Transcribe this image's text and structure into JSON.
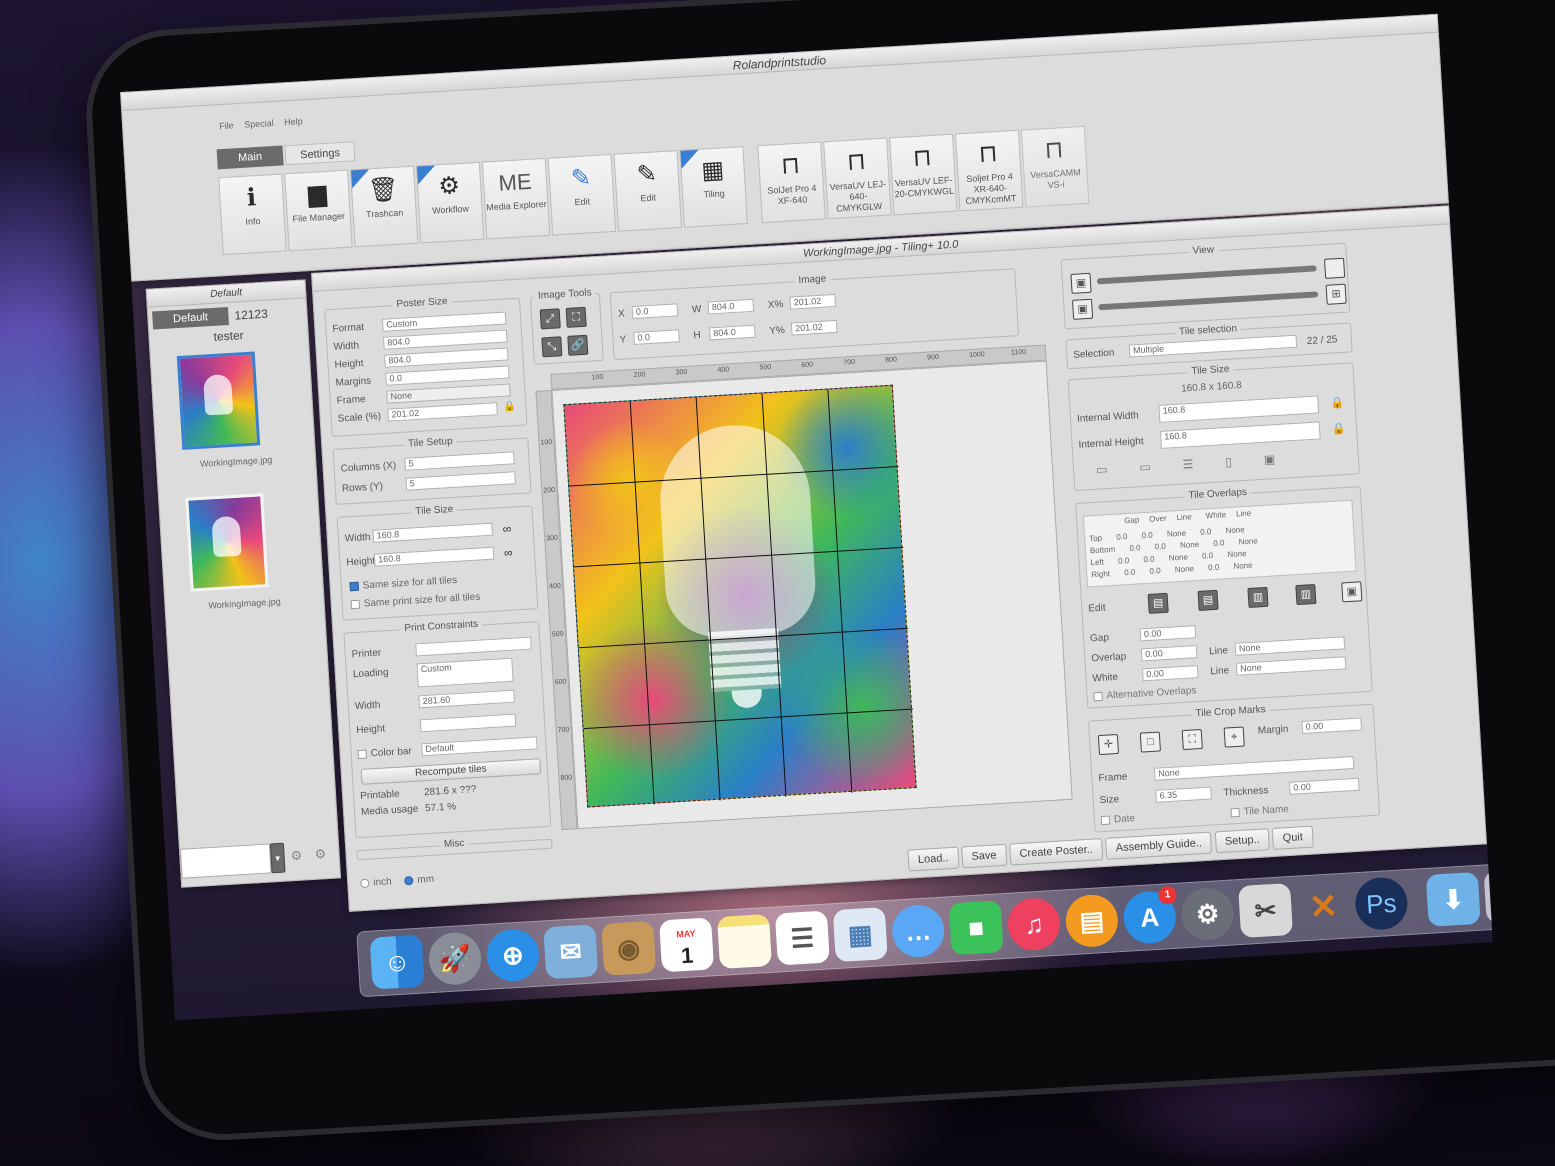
{
  "app_title": "Rolandprintstudio",
  "menu": [
    "File",
    "Special",
    "Help"
  ],
  "tabs": {
    "main": "Main",
    "settings": "Settings"
  },
  "toolbar": {
    "info": "Info",
    "file_manager": "File Manager",
    "trashcan": "Trashcan",
    "workflow": "Workflow",
    "media_explorer": "Media Explorer",
    "media_logo": "ME",
    "edit1": "Edit",
    "edit2": "Edit",
    "tiling": "Tiling"
  },
  "printers": [
    {
      "line1": "SolJet Pro 4",
      "line2": "XF-640"
    },
    {
      "line1": "VersaUV LEJ-",
      "line2": "640-CMYKGLW"
    },
    {
      "line1": "VersaUV LEF-",
      "line2": "20-CMYKWGL"
    },
    {
      "line1": "Soljet Pro 4",
      "line2": "XR-640-CMYKcmMT"
    },
    {
      "line1": "VersaCAMM",
      "line2": "VS-i"
    }
  ],
  "queue": {
    "title": "Default",
    "tab": "Default",
    "count": "12123",
    "user": "tester",
    "thumb1": "WorkingImage.jpg",
    "thumb2": "WorkingImage.jpg"
  },
  "tiling_title": "WorkingImage.jpg - Tiling+ 10.0",
  "poster_size": {
    "title": "Poster Size",
    "format_label": "Format",
    "format": "Custom",
    "width_label": "Width",
    "width": "804.0",
    "height_label": "Height",
    "height": "804.0",
    "margins_label": "Margins",
    "margins": "0.0",
    "frame_label": "Frame",
    "frame": "None",
    "scale_label": "Scale (%)",
    "scale": "201.02"
  },
  "tile_setup": {
    "title": "Tile Setup",
    "columns_label": "Columns (X)",
    "columns": "5",
    "rows_label": "Rows (Y)",
    "rows": "5"
  },
  "tile_size_left": {
    "title": "Tile Size",
    "width_label": "Width",
    "width": "160.8",
    "height_label": "Height",
    "height": "160.8",
    "same_size": "Same size for all tiles",
    "same_print": "Same print size for all tiles"
  },
  "print_constraints": {
    "title": "Print Constraints",
    "printer_label": "Printer",
    "loading_label": "Loading",
    "loading": "Custom",
    "width_label": "Width",
    "width": "281.60",
    "height_label": "Height",
    "color_bar_label": "Color bar",
    "color_bar": "Default",
    "recompute": "Recompute tiles",
    "printable_label": "Printable",
    "printable": "281.6 x ???",
    "media_usage_label": "Media usage",
    "media_usage": "57.1 %",
    "misc": "Misc"
  },
  "units": {
    "inch": "inch",
    "mm": "mm"
  },
  "image_tools": {
    "title": "Image Tools",
    "image": "Image",
    "x": "0.0",
    "w": "804.0",
    "xpct": "201.02",
    "y": "0.0",
    "h": "804.0",
    "ypct": "201.02",
    "x_label": "X",
    "w_label": "W",
    "xpct_label": "X%",
    "y_label": "Y",
    "h_label": "H",
    "ypct_label": "Y%"
  },
  "ruler_top": [
    "100",
    "200",
    "300",
    "400",
    "500",
    "600",
    "700",
    "800",
    "900",
    "1000",
    "1100"
  ],
  "ruler_left": [
    "100",
    "200",
    "300",
    "400",
    "500",
    "600",
    "700",
    "800"
  ],
  "view": {
    "title": "View"
  },
  "tile_selection": {
    "title": "Tile selection",
    "selection_label": "Selection",
    "selection": "Multiple",
    "count": "22 / 25"
  },
  "tile_size_right": {
    "title": "Tile Size",
    "dims": "160.8 x 160.8",
    "iw_label": "Internal Width",
    "iw": "160.8",
    "ih_label": "Internal Height",
    "ih": "160.8"
  },
  "tile_overlaps": {
    "title": "Tile Overlaps",
    "headers": [
      "",
      "Gap",
      "Over",
      "Line",
      "White",
      "Line"
    ],
    "rows": [
      [
        "Top",
        "0.0",
        "0.0",
        "None",
        "0.0",
        "None"
      ],
      [
        "Bottom",
        "0.0",
        "0.0",
        "None",
        "0.0",
        "None"
      ],
      [
        "Left",
        "0.0",
        "0.0",
        "None",
        "0.0",
        "None"
      ],
      [
        "Right",
        "0.0",
        "0.0",
        "None",
        "0.0",
        "None"
      ]
    ],
    "edit_label": "Edit",
    "gap_label": "Gap",
    "gap": "0.00",
    "overlap_label": "Overlap",
    "overlap": "0.00",
    "white_label": "White",
    "white": "0.00",
    "line_label": "Line",
    "line1": "None",
    "line2": "None",
    "alt": "Alternative Overlaps"
  },
  "crop_marks": {
    "title": "Tile Crop Marks",
    "margin_label": "Margin",
    "margin": "0.00",
    "frame_label": "Frame",
    "frame": "None",
    "size_label": "Size",
    "size": "6.35",
    "thickness_label": "Thickness",
    "thickness": "0.00",
    "date": "Date",
    "tile_name": "Tile Name"
  },
  "actions": {
    "load": "Load..",
    "save": "Save",
    "create": "Create Poster..",
    "assembly": "Assembly Guide..",
    "setup": "Setup..",
    "quit": "Quit"
  },
  "dock": {
    "calendar_month": "MAY",
    "calendar_day": "1",
    "appstore_badge": "1",
    "ps": "Ps"
  },
  "colors": {
    "accent": "#3a7fd2",
    "panel": "#dcdcdc",
    "dark_icon": "#2b2b2b"
  }
}
